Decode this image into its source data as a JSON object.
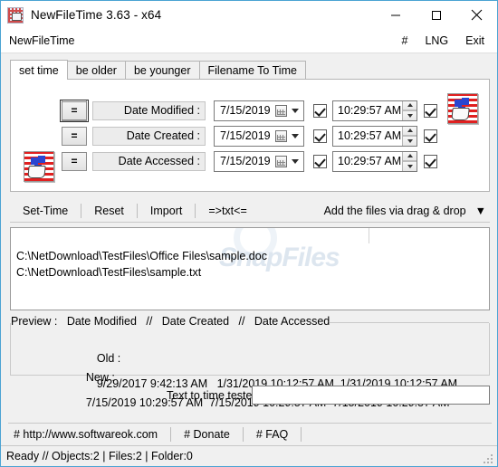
{
  "window": {
    "title": "NewFileTime 3.63 - x64",
    "icon": "stamp-icon",
    "minimize": "minimize-icon",
    "maximize": "maximize-icon",
    "close": "close-icon"
  },
  "menubar": {
    "app_label": "NewFileTime",
    "hash": "#",
    "lng": "LNG",
    "exit": "Exit"
  },
  "tabs": [
    {
      "label": "set time",
      "active": true
    },
    {
      "label": "be older",
      "active": false
    },
    {
      "label": "be younger",
      "active": false
    },
    {
      "label": "Filename To Time",
      "active": false
    }
  ],
  "settime": {
    "globe_button": "refresh-globe-button",
    "stamp_left": "time-stamp-icon-left",
    "stamp_right": "time-stamp-icon-right",
    "eq_label": "=",
    "rows": [
      {
        "label": "Date Modified :",
        "date": "7/15/2019",
        "date_checked": true,
        "time": "10:29:57 AM",
        "time_checked": true
      },
      {
        "label": "Date Created :",
        "date": "7/15/2019",
        "date_checked": true,
        "time": "10:29:57 AM",
        "time_checked": true
      },
      {
        "label": "Date Accessed :",
        "date": "7/15/2019",
        "date_checked": true,
        "time": "10:29:57 AM",
        "time_checked": true
      }
    ]
  },
  "commandbar": {
    "set_time": "Set-Time",
    "reset": "Reset",
    "import": "Import",
    "to_txt": "=>txt<=",
    "drag_drop": "Add the files via drag & drop",
    "drag_drop_caret": "▼"
  },
  "filelist": {
    "watermark_prefix": "(C)",
    "watermark": "SnapFiles",
    "files": [
      "C:\\NetDownload\\TestFiles\\Office Files\\sample.doc",
      "C:\\NetDownload\\TestFiles\\sample.txt"
    ]
  },
  "preview": {
    "legend": "Preview :   Date Modified   //   Date Created   //   Date Accessed",
    "old_label": "Old :",
    "old_value": "9/29/2017 9:42:13 AM   1/31/2019 10:12:57 AM  1/31/2019 10:12:57 AM",
    "new_label": "New :",
    "new_value": "7/15/2019 10:29:57 AM  7/15/2019 10:29:57 AM  7/15/2019 10:29:57 AM"
  },
  "tester": {
    "label": "Text to time tester",
    "value": "",
    "placeholder": ""
  },
  "links": [
    {
      "label": "# http://www.softwareok.com"
    },
    {
      "label": "# Donate"
    },
    {
      "label": "# FAQ"
    }
  ],
  "statusbar": {
    "text": "Ready // Objects:2 | Files:2  | Folder:0"
  },
  "colors": {
    "window_border": "#4ba3d3",
    "face": "#f0f0f0",
    "field": "#ffffff",
    "stamp_red": "#e02020",
    "stamp_blue": "#2a45d0",
    "globe_green": "#19a33a"
  }
}
